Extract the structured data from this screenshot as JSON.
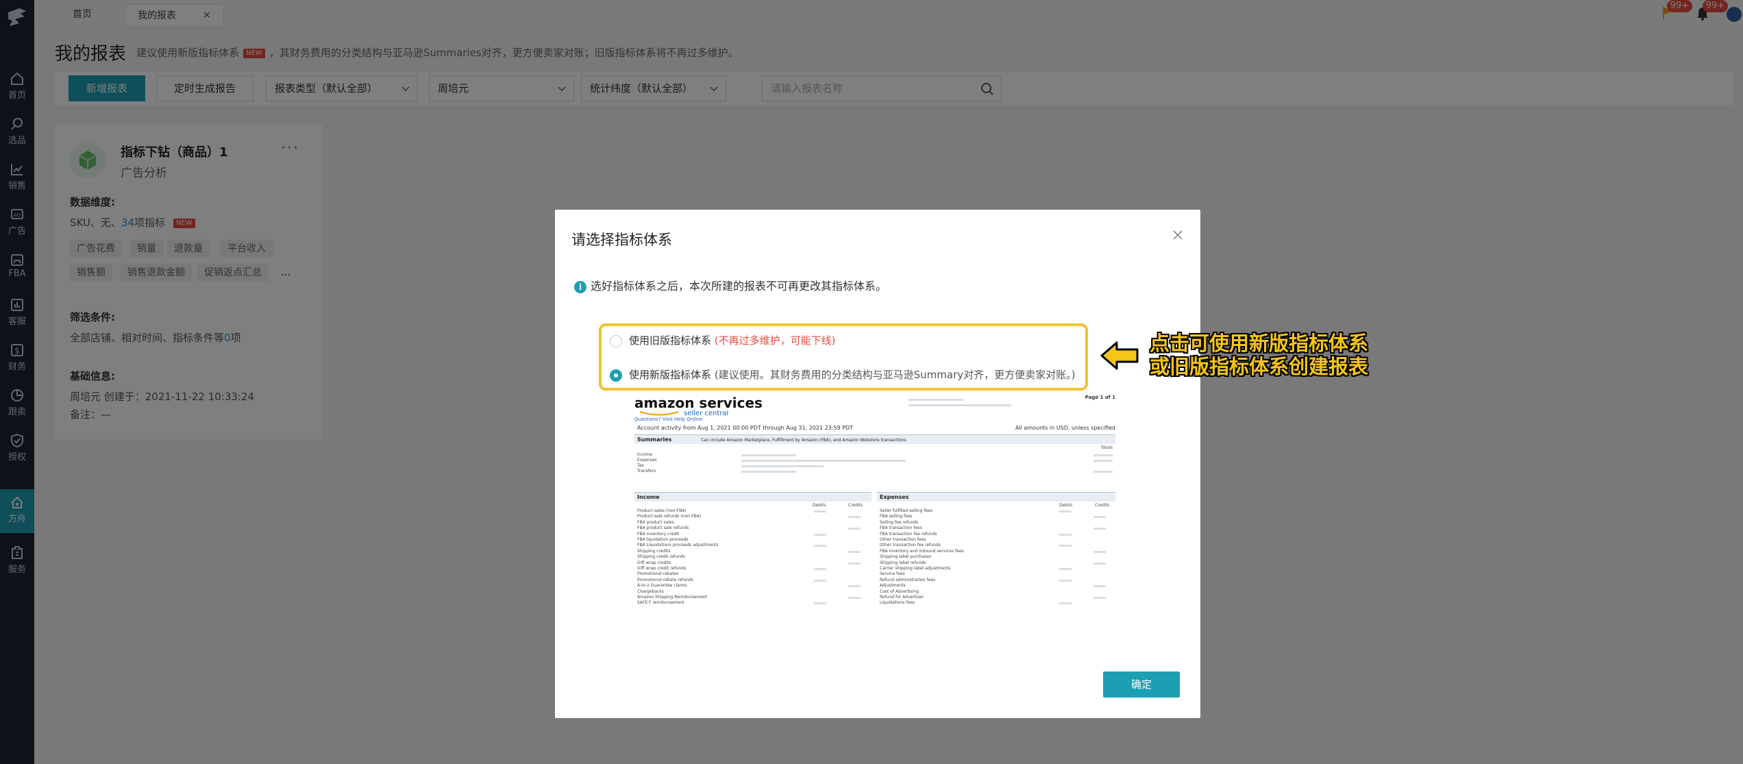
{
  "topbar": {
    "tabs": [
      {
        "label": "首页"
      },
      {
        "label": "我的报表"
      }
    ],
    "badges": [
      "99+",
      "99+"
    ]
  },
  "sidebar": {
    "items": [
      {
        "label": "首页",
        "icon": "home-icon"
      },
      {
        "label": "选品",
        "icon": "search-icon"
      },
      {
        "label": "销售",
        "icon": "chart-line-icon"
      },
      {
        "label": "广告",
        "icon": "ad-icon"
      },
      {
        "label": "FBA",
        "icon": "warehouse-icon"
      },
      {
        "label": "客服",
        "icon": "bar-chart-icon"
      },
      {
        "label": "财务",
        "icon": "dollar-icon"
      },
      {
        "label": "跟卖",
        "icon": "pie-chart-icon"
      },
      {
        "label": "授权",
        "icon": "shield-icon"
      },
      {
        "label": "方舟",
        "icon": "ark-icon",
        "active": true
      },
      {
        "label": "服务",
        "icon": "building-icon"
      }
    ]
  },
  "header": {
    "title": "我的报表",
    "hint_before": "建议使用新版指标体系",
    "new_tag": "NEW",
    "hint_after": "，其财务费用的分类结构与亚马逊Summaries对齐，更方便卖家对账；旧版指标体系将不再过多维护。"
  },
  "toolbar": {
    "add_label": "新增报表",
    "schedule_label": "定时生成报告",
    "report_type": "报表类型（默认全部）",
    "owner": "周培元",
    "dimension": "统计纬度（默认全部）",
    "search_placeholder": "请输入报表名称"
  },
  "card": {
    "title": "指标下钻（商品）1",
    "subtitle": "广告分析",
    "more": "···",
    "dim_label": "数据维度:",
    "dim_text_before": "SKU、无、",
    "dim_count": "34",
    "dim_text_after": "项指标",
    "dim_new": "NEW",
    "chips": [
      "广告花费",
      "销量",
      "退款量",
      "平台收入",
      "销售额",
      "销售退款金额",
      "促销返点汇总"
    ],
    "chips_more": "...",
    "filter_label": "筛选条件:",
    "filter_before": "全部店铺、相对时间、指标条件等",
    "filter_count": "0",
    "filter_after": "项",
    "base_label": "基础信息:",
    "created": "周培元 创建于：2021-11-22 10:33:24",
    "remark": "备注：—"
  },
  "modal": {
    "title": "请选择指标体系",
    "info": "选好指标体系之后，本次所建的报表不可再更改其指标体系。",
    "option_old_label": "使用旧版指标体系",
    "option_old_warn": "(不再过多维护，可能下线)",
    "option_new_label": "使用新版指标体系",
    "option_new_note": "(建议使用。其财务费用的分类结构与亚马逊Summary对齐，更方便卖家对账。)",
    "selected": "new",
    "ok_label": "确定"
  },
  "preview": {
    "brand": "amazon services",
    "brand_sub": "seller central",
    "brand_links": "Questions? Visit Help Online",
    "page_of": "Page 1 of 1",
    "account_line": "Account activity from Aug 1, 2021 00:00 PDT through Aug 31, 2021 23:59 PDT",
    "amounts_note": "All amounts in USD, unless specified",
    "summaries_title": "Summaries",
    "summaries_desc": "Can include Amazon Marketplace, Fulfillment by Amazon (FBA), and Amazon Webstore transactions",
    "totals": "Totals",
    "summary_rows": [
      "Income",
      "Expenses",
      "Tax",
      "Transfers"
    ],
    "income_title": "Income",
    "expenses_title": "Expenses",
    "debits": "Debits",
    "credits": "Credits",
    "income_rows": [
      "Product sales (non-FBA)",
      "Product sale refunds (non-FBA)",
      "FBA product sales",
      "FBA product sale refunds",
      "FBA inventory credit",
      "FBA liquidation proceeds",
      "FBA Liquidations proceeds adjustments",
      "Shipping credits",
      "Shipping credit refunds",
      "Gift wrap credits",
      "Gift wrap credit refunds",
      "Promotional rebates",
      "Promotional rebate refunds",
      "A-to-z Guarantee claims",
      "Chargebacks",
      "Amazon Shipping Reimbursement",
      "SAFE-T reimbursement"
    ],
    "expense_rows": [
      "Seller fulfilled selling fees",
      "FBA selling fees",
      "Selling fee refunds",
      "FBA transaction fees",
      "FBA transaction fee refunds",
      "Other transaction fees",
      "Other transaction fee refunds",
      "FBA inventory and inbound services fees",
      "Shipping label purchases",
      "Shipping label refunds",
      "Carrier shipping label adjustments",
      "Service fees",
      "Refund administration fees",
      "Adjustments",
      "Cost of Advertising",
      "Refund for Advertiser",
      "Liquidations fees"
    ]
  },
  "annotation": {
    "line1": "点击可使用新版指标体系",
    "line2": "或旧版指标体系创建报表"
  },
  "colors": {
    "accent": "#1d9fb3",
    "sidebar": "#1b2530",
    "warn": "#e64b3c",
    "highlight": "#f2c033"
  }
}
